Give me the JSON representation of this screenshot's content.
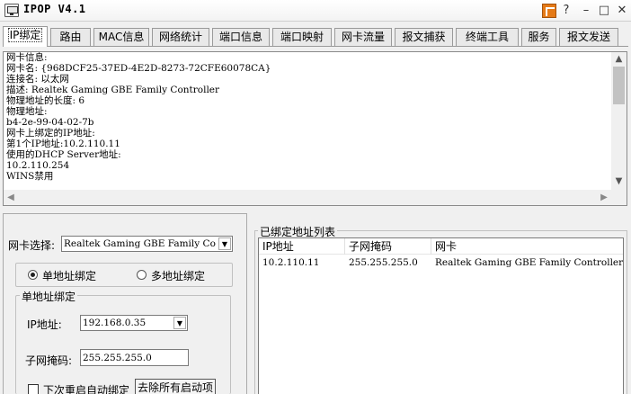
{
  "window": {
    "title": "IPOP V4.1"
  },
  "title_controls": {
    "help": "?",
    "minimize": "–",
    "maximize": "□",
    "close": "✕"
  },
  "tabs": [
    {
      "label": "IP绑定",
      "active": true
    },
    {
      "label": "路由"
    },
    {
      "label": "MAC信息"
    },
    {
      "label": "网络统计"
    },
    {
      "label": "端口信息"
    },
    {
      "label": "端口映射"
    },
    {
      "label": "网卡流量"
    },
    {
      "label": "报文捕获"
    },
    {
      "label": "终端工具"
    },
    {
      "label": "服务"
    },
    {
      "label": "报文发送"
    }
  ],
  "info": {
    "lines": [
      "网卡信息:",
      "网卡名: {968DCF25-37ED-4E2D-8273-72CFE60078CA}",
      "连接名: 以太网",
      "描述: Realtek Gaming GBE Family Controller",
      "物理地址的长度: 6",
      "物理地址:",
      "b4-2e-99-04-02-7b",
      "网卡上绑定的IP地址:",
      "第1个IP地址:10.2.110.11",
      "使用的DHCP Server地址:",
      "10.2.110.254",
      "WINS禁用"
    ]
  },
  "left": {
    "adapter_label": "网卡选择:",
    "adapter_value": "Realtek Gaming GBE Family Co",
    "radio_single": "单地址绑定",
    "radio_multi": "多地址绑定",
    "single_group_title": "单地址绑定",
    "ip_label": "IP地址:",
    "ip_value": "192.168.0.35",
    "mask_label": "子网掩码:",
    "mask_value": "255.255.255.0",
    "auto_bind_label": "下次重启自动绑定",
    "remove_all_button": "去除所有启动项"
  },
  "right": {
    "group_title": "已绑定地址列表",
    "columns": [
      "IP地址",
      "子网掩码",
      "网卡"
    ],
    "rows": [
      [
        "10.2.110.11",
        "255.255.255.0",
        "Realtek Gaming GBE Family Controller"
      ]
    ]
  }
}
